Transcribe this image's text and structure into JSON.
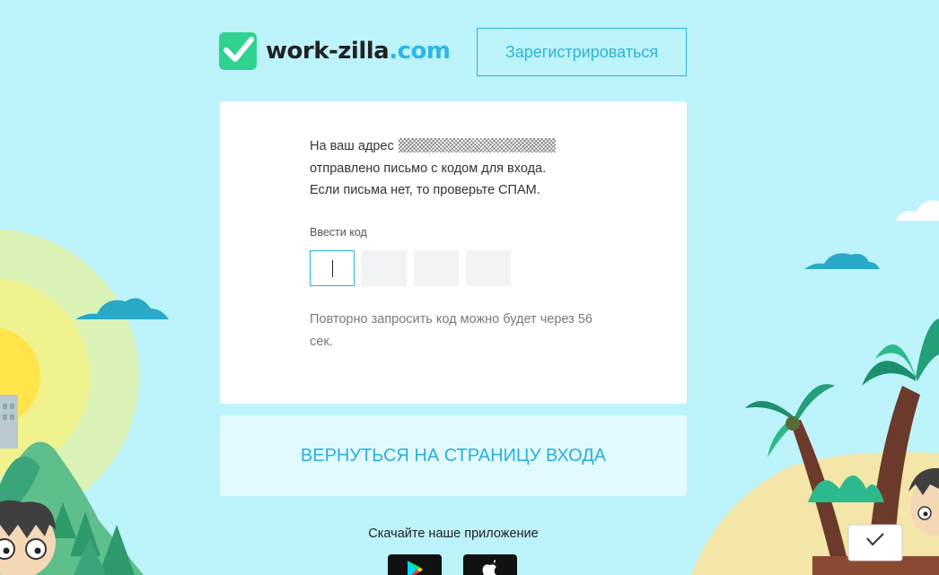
{
  "header": {
    "logo_main": "work-zilla",
    "logo_domain": ".com",
    "register_label": "Зарегистрироваться"
  },
  "card": {
    "line1_prefix": "На ваш адрес",
    "line2": "отправлено письмо с кодом для входа.",
    "line3": "Если письма нет, то проверьте СПАМ.",
    "code_label": "Ввести код",
    "resend_text": "Повторно запросить код можно будет через 56 сек."
  },
  "back_button_label": "ВЕРНУТЬСЯ НА СТРАНИЦУ ВХОДА",
  "download": {
    "label": "Скачайте наше приложение",
    "stores": [
      "google-play-icon",
      "apple-icon"
    ]
  },
  "colors": {
    "background": "#bdf3fb",
    "accent": "#2cb3d8",
    "logo_green": "#2fd38f"
  }
}
